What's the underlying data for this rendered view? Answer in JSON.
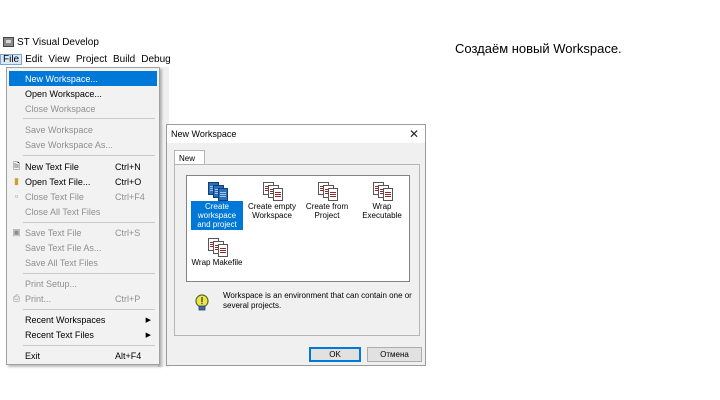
{
  "window": {
    "title": "ST Visual Develop"
  },
  "menubar": {
    "items": [
      "File",
      "Edit",
      "View",
      "Project",
      "Build",
      "Debug"
    ]
  },
  "file_menu": {
    "new_workspace": "New Workspace...",
    "open_workspace": "Open Workspace...",
    "close_workspace": "Close Workspace",
    "save_workspace": "Save Workspace",
    "save_workspace_as": "Save Workspace As...",
    "new_text_file": "New Text File",
    "new_text_file_sc": "Ctrl+N",
    "open_text_file": "Open Text File...",
    "open_text_file_sc": "Ctrl+O",
    "close_text_file": "Close Text File",
    "close_text_file_sc": "Ctrl+F4",
    "close_all_text_files": "Close All Text Files",
    "save_text_file": "Save Text File",
    "save_text_file_sc": "Ctrl+S",
    "save_text_file_as": "Save Text File As...",
    "save_all_text_files": "Save All Text Files",
    "print_setup": "Print Setup...",
    "print": "Print...",
    "print_sc": "Ctrl+P",
    "recent_workspaces": "Recent Workspaces",
    "recent_text_files": "Recent Text Files",
    "exit": "Exit",
    "exit_sc": "Alt+F4"
  },
  "dialog": {
    "title": "New Workspace",
    "close_glyph": "✕",
    "tab": "New",
    "items": {
      "create_ws_proj": [
        "Create",
        "workspace",
        "and project"
      ],
      "create_empty": [
        "Create empty",
        "Workspace"
      ],
      "create_from": [
        "Create from",
        "Project"
      ],
      "wrap_exec": [
        "Wrap",
        "Executable"
      ],
      "wrap_make": [
        "Wrap Makefile"
      ]
    },
    "info": "Workspace is an environment that can contain one or several projects.",
    "ok": "OK",
    "cancel": "Отмена"
  },
  "annotation": "Создаём новый Workspace.",
  "colors": {
    "highlight": "#0078d7",
    "menu_bg": "#f2f2f2",
    "dialog_bg": "#f0f0f0"
  },
  "icons": [
    "app-icon",
    "project-icon",
    "bulb-icon",
    "submenu-arrow-icon"
  ]
}
